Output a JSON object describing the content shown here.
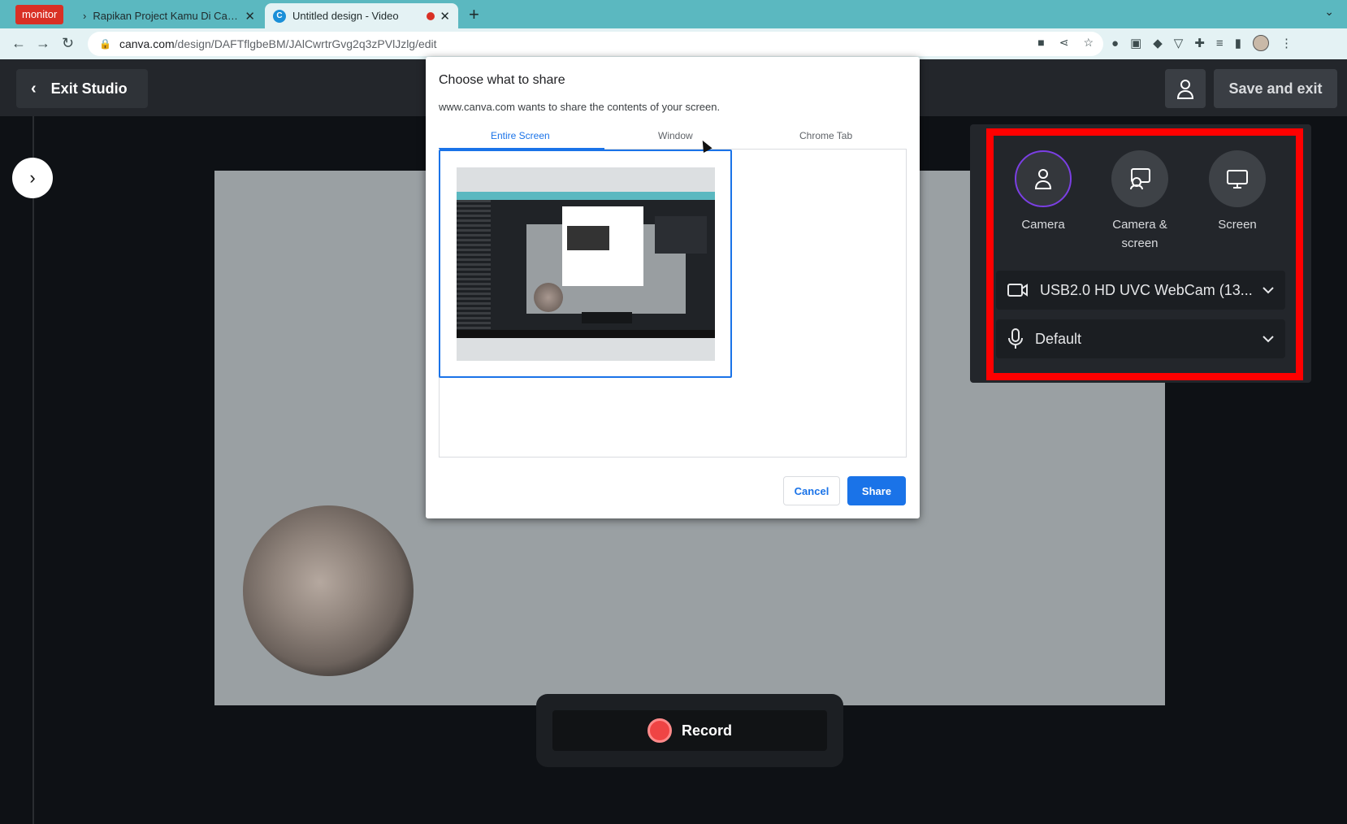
{
  "browser": {
    "monitor_badge": "monitor",
    "tabs": [
      {
        "title": "Rapikan Project Kamu Di Canv..."
      },
      {
        "title": "Untitled design - Video"
      }
    ],
    "url_host": "canva.com",
    "url_path": "/design/DAFTflgbeBM/JAlCwrtrGvg2q3zPVlJzlg/edit"
  },
  "studio": {
    "exit_label": "Exit Studio",
    "save_exit_label": "Save and exit",
    "record_label": "Record"
  },
  "panel": {
    "modes": [
      {
        "label": "Camera",
        "icon": "person-icon",
        "selected": true
      },
      {
        "label": "Camera &\nscreen",
        "icon": "camera-screen-icon",
        "selected": false
      },
      {
        "label": "Screen",
        "icon": "monitor-icon",
        "selected": false
      }
    ],
    "camera_device": "USB2.0 HD UVC WebCam (13...",
    "microphone_device": "Default"
  },
  "share_dialog": {
    "title": "Choose what to share",
    "subtitle": "www.canva.com wants to share the contents of your screen.",
    "tabs": [
      "Entire Screen",
      "Window",
      "Chrome Tab"
    ],
    "cancel_label": "Cancel",
    "share_label": "Share"
  },
  "colors": {
    "highlight": "#ff0000",
    "accent_blue": "#1a73e8",
    "record_red": "#ef4444",
    "selected_purple": "#7b3fe4"
  }
}
